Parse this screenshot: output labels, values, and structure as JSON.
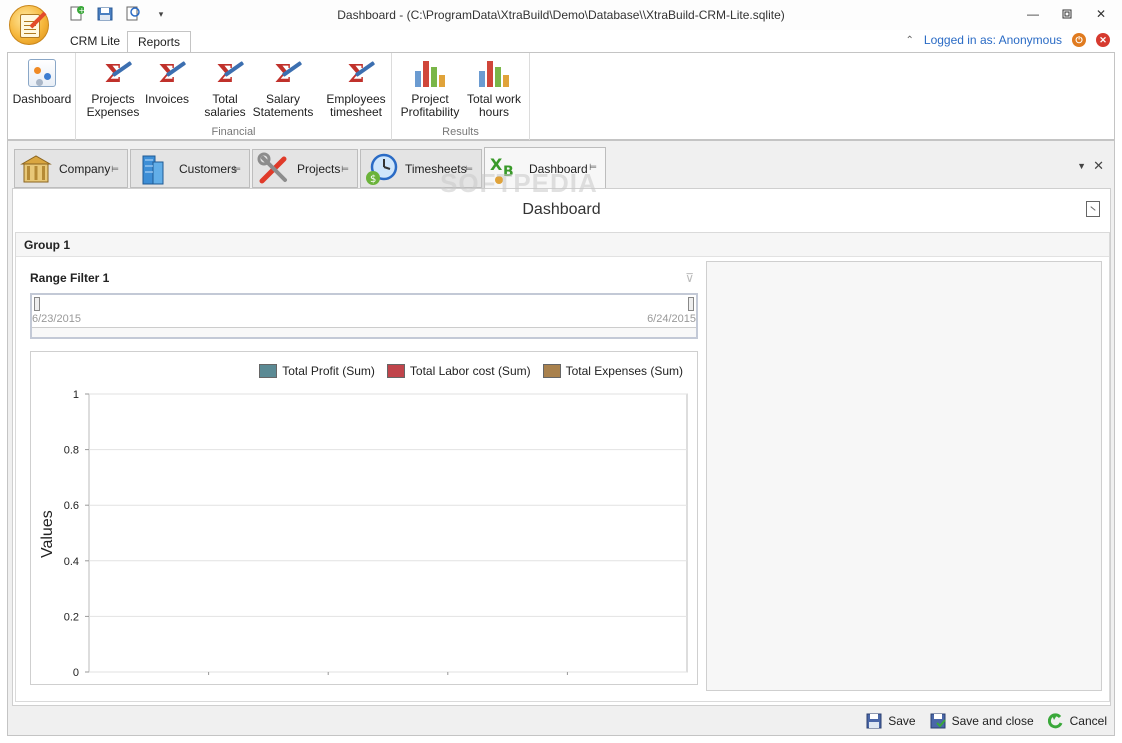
{
  "window": {
    "title": "Dashboard - (C:\\ProgramData\\XtraBuild\\Demo\\Database\\\\XtraBuild-CRM-Lite.sqlite)",
    "controls": [
      "minimize-icon",
      "restore-icon",
      "close-icon"
    ]
  },
  "quick_access": [
    "new-doc-icon",
    "save-icon",
    "refresh-icon",
    "customize-icon"
  ],
  "ribbon_tabs": [
    {
      "label": "CRM Lite",
      "active": false
    },
    {
      "label": "Reports",
      "active": true
    }
  ],
  "login": {
    "text": "Logged in as: Anonymous"
  },
  "ribbon": {
    "groups": [
      {
        "label": "",
        "buttons": [
          {
            "label": "Dashboard",
            "icon": "dashboard-icon"
          }
        ]
      },
      {
        "label": "Financial",
        "buttons": [
          {
            "label": "Projects\nExpenses",
            "icon": "sigma-report-icon"
          },
          {
            "label": "Invoices",
            "icon": "sigma-report-icon"
          },
          {
            "label": "Total\nsalaries",
            "icon": "sigma-report-icon"
          },
          {
            "label": "Salary\nStatements",
            "icon": "sigma-report-icon"
          },
          {
            "label": "Employees\ntimesheet",
            "icon": "sigma-report-icon"
          }
        ]
      },
      {
        "label": "Results",
        "buttons": [
          {
            "label": "Project\nProfitability",
            "icon": "bar-chart-icon"
          },
          {
            "label": "Total work\nhours",
            "icon": "bar-chart-icon"
          }
        ]
      }
    ]
  },
  "doc_tabs": [
    {
      "label": "Company",
      "icon": "building-icon",
      "active": false
    },
    {
      "label": "Customers",
      "icon": "skyscraper-icon",
      "active": false
    },
    {
      "label": "Projects",
      "icon": "tools-icon",
      "active": false
    },
    {
      "label": "Timesheets",
      "icon": "clock-money-icon",
      "active": false
    },
    {
      "label": "Dashboard",
      "icon": "xb-dashboard-icon",
      "active": true
    }
  ],
  "watermark": "SOFTPEDIA",
  "dashboard": {
    "title": "Dashboard",
    "group_title": "Group 1",
    "range_filter": {
      "title": "Range Filter 1",
      "start_date": "6/23/2015",
      "end_date": "6/24/2015"
    }
  },
  "chart_data": {
    "type": "bar",
    "categories": [],
    "series": [
      {
        "name": "Total Profit (Sum)",
        "color": "#5b8a94",
        "values": []
      },
      {
        "name": "Total Labor cost (Sum)",
        "color": "#c0444b",
        "values": []
      },
      {
        "name": "Total Expenses (Sum)",
        "color": "#a9814d",
        "values": []
      }
    ],
    "ylabel": "Values",
    "ylim": [
      0,
      1
    ],
    "yticks": [
      "0",
      "0.2",
      "0.4",
      "0.6",
      "0.8",
      "1"
    ],
    "grid": true,
    "legend": "top-right"
  },
  "bottom_bar": {
    "save": "Save",
    "save_close": "Save and close",
    "cancel": "Cancel"
  }
}
